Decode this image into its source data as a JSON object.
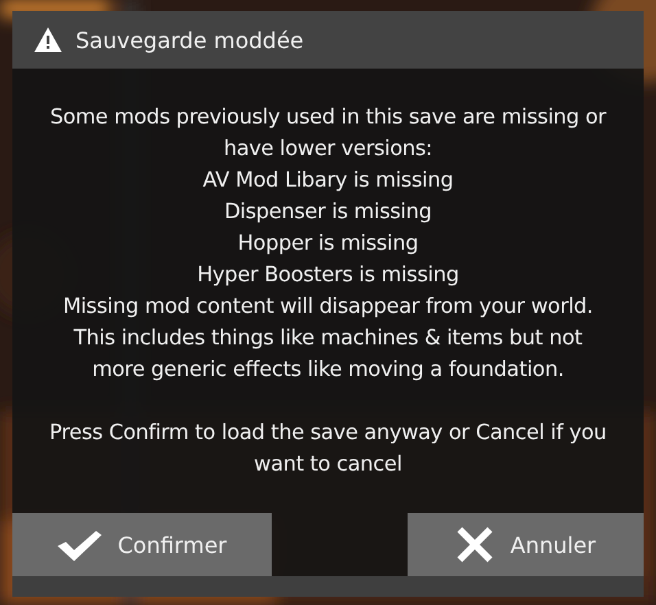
{
  "dialog": {
    "title": "Sauvegarde moddée",
    "intro": "Some mods previously used in this save are missing or have lower versions:",
    "missing_mods": [
      "AV Mod Libary is missing",
      "Dispenser is missing",
      "Hopper is missing",
      "Hyper Boosters is missing"
    ],
    "warning": "Missing mod content will disappear from your world. This includes things like machines & items but not more generic effects like moving a foundation.",
    "prompt": "Press Confirm to load the save anyway or Cancel if you want to cancel",
    "buttons": [
      {
        "kind": "confirm",
        "label": "Confirmer"
      },
      {
        "kind": "cancel",
        "label": "Annuler"
      }
    ]
  }
}
